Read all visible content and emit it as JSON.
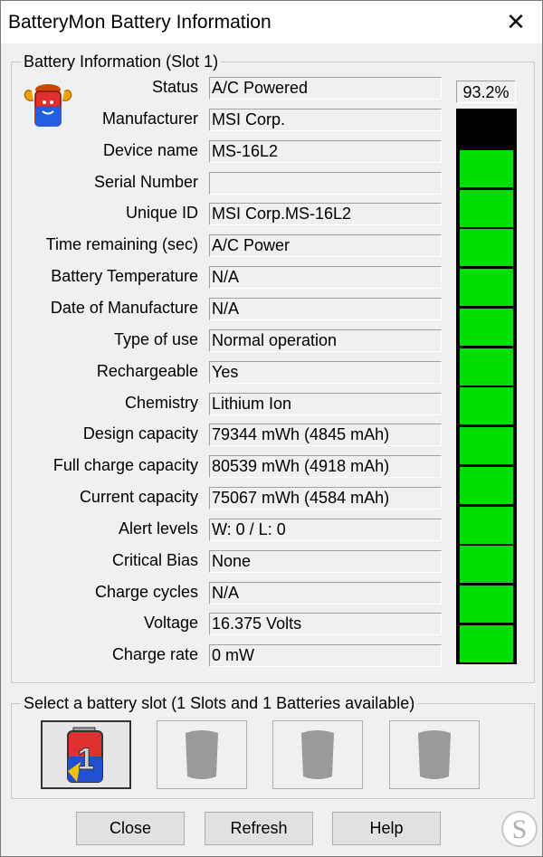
{
  "window": {
    "title": "BatteryMon Battery Information",
    "close_glyph": "✕"
  },
  "info_group": {
    "legend": "Battery Information (Slot 1)",
    "rows": [
      {
        "label": "Status",
        "value": "A/C Powered"
      },
      {
        "label": "Manufacturer",
        "value": "MSI Corp."
      },
      {
        "label": "Device name",
        "value": "MS-16L2"
      },
      {
        "label": "Serial Number",
        "value": ""
      },
      {
        "label": "Unique ID",
        "value": "MSI Corp.MS-16L2"
      },
      {
        "label": "Time remaining (sec)",
        "value": "A/C Power"
      },
      {
        "label": "Battery Temperature",
        "value": "N/A"
      },
      {
        "label": "Date of Manufacture",
        "value": "N/A"
      },
      {
        "label": "Type of use",
        "value": "Normal operation"
      },
      {
        "label": "Rechargeable",
        "value": "Yes"
      },
      {
        "label": "Chemistry",
        "value": "Lithium Ion"
      },
      {
        "label": "Design capacity",
        "value": "79344 mWh (4845 mAh)"
      },
      {
        "label": "Full charge capacity",
        "value": "80539 mWh (4918 mAh)"
      },
      {
        "label": "Current capacity",
        "value": "75067 mWh (4584 mAh)"
      },
      {
        "label": "Alert levels",
        "value": "W: 0 / L: 0"
      },
      {
        "label": "Critical Bias",
        "value": "None"
      },
      {
        "label": "Charge cycles",
        "value": "N/A"
      },
      {
        "label": "Voltage",
        "value": "16.375 Volts"
      },
      {
        "label": "Charge rate",
        "value": "0 mW"
      }
    ],
    "charge_percent_text": "93.2%",
    "charge_fraction": 0.932,
    "meter_colors": {
      "filled": "#00dd00",
      "empty": "#000000"
    },
    "icon": "battery-app-icon"
  },
  "slot_group": {
    "legend": "Select a battery slot (1 Slots and 1 Batteries available)",
    "slots": [
      {
        "number": "1",
        "active": true,
        "icon": "battery-slot-icon"
      },
      {
        "number": "",
        "active": false,
        "icon": "empty-slot-icon"
      },
      {
        "number": "",
        "active": false,
        "icon": "empty-slot-icon"
      },
      {
        "number": "",
        "active": false,
        "icon": "empty-slot-icon"
      }
    ]
  },
  "buttons": {
    "close": "Close",
    "refresh": "Refresh",
    "help": "Help"
  },
  "watermark": {
    "letter": "S"
  }
}
